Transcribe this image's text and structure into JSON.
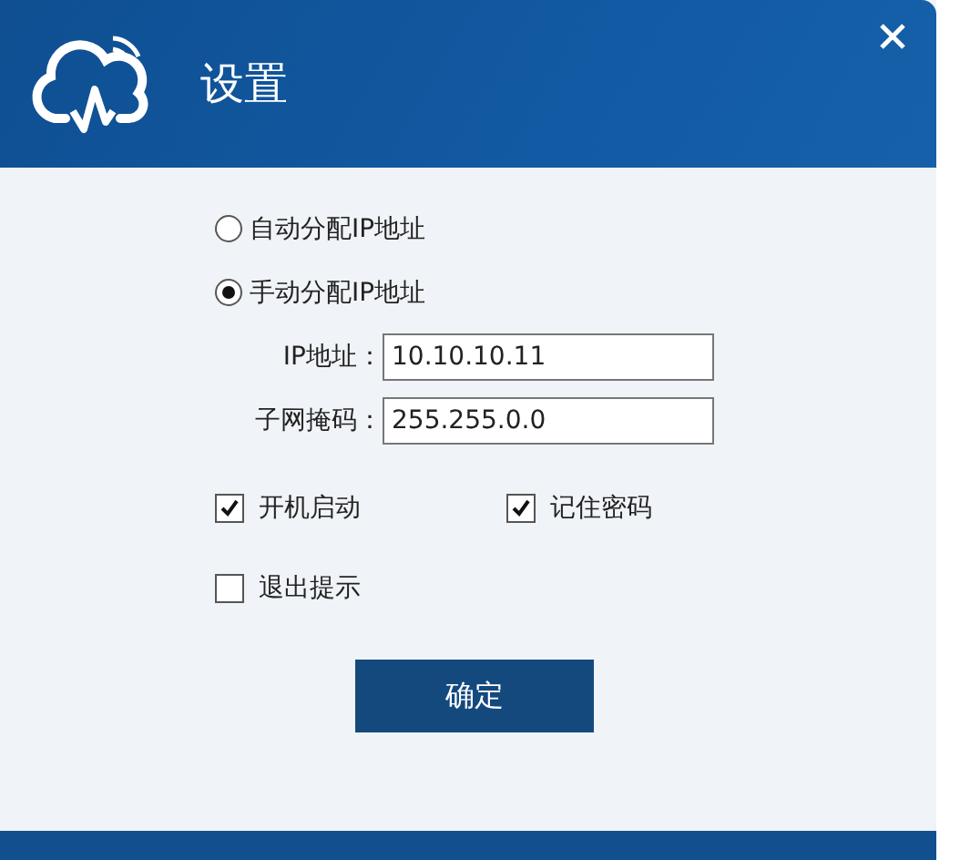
{
  "window": {
    "title": "设置"
  },
  "ip_mode": [
    {
      "label": "自动分配IP地址",
      "selected": false
    },
    {
      "label": "手动分配IP地址",
      "selected": true
    }
  ],
  "fields": [
    {
      "label": "IP地址：",
      "value": "10.10.10.11"
    },
    {
      "label": "子网掩码：",
      "value": "255.255.0.0"
    }
  ],
  "options": [
    {
      "label": "开机启动",
      "checked": true
    },
    {
      "label": "记住密码",
      "checked": true
    },
    {
      "label": "退出提示",
      "checked": false
    }
  ],
  "buttons": [
    "确定"
  ]
}
